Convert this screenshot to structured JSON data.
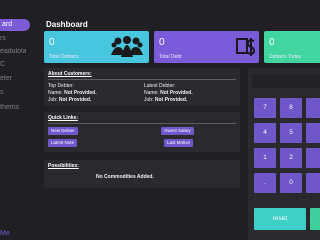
{
  "sidebar": {
    "items": [
      {
        "label": "ard",
        "active": true
      },
      {
        "label": "rs"
      },
      {
        "label": "eadulola"
      },
      {
        "label": "C"
      },
      {
        "label": "eter"
      },
      {
        "label": "s"
      },
      {
        "label": "thems"
      }
    ],
    "footer": "Me"
  },
  "page_title": "Dashboard",
  "stats": [
    {
      "value": "0",
      "label": "Total Debters",
      "color": "#48c6dd",
      "icon": "people-group-icon"
    },
    {
      "value": "0",
      "label": "Total Debt",
      "color": "#7a5cd8",
      "icon": "dollar-sign-icon"
    },
    {
      "value": "0",
      "label": "Debters Today",
      "color": "#41d5a0",
      "icon": ""
    }
  ],
  "about": {
    "title": "About Customers:",
    "top_debter_label": "Top Debter:",
    "top_name_label": "Name:",
    "top_name_value": "Not Provided.",
    "top_job_label": "Job:",
    "top_job_value": "Not Provided.",
    "latest_debter_label": "Latest Debter:",
    "latest_name_label": "Name:",
    "latest_name_value": "Not Provided.",
    "latest_job_label": "Job:",
    "latest_job_value": "Not Provided."
  },
  "quick_links": {
    "title": "Quick Links:",
    "new_debter": "New Debter",
    "lowest_salary": "Owest Salary",
    "latest_note": "Latest Note",
    "last_motive": "Last Motive"
  },
  "possibilities": {
    "title": "Possibilities:",
    "empty_text": "No Commodities Added."
  },
  "keypad": {
    "keys": [
      "7",
      "8",
      "4",
      "5",
      "1",
      "2",
      ".",
      "0"
    ],
    "reset_label": "reset"
  },
  "colors": {
    "accent": "#7a5cd8",
    "cyan": "#48c6dd",
    "green": "#41d5a0",
    "background": "#1b1b1f"
  }
}
